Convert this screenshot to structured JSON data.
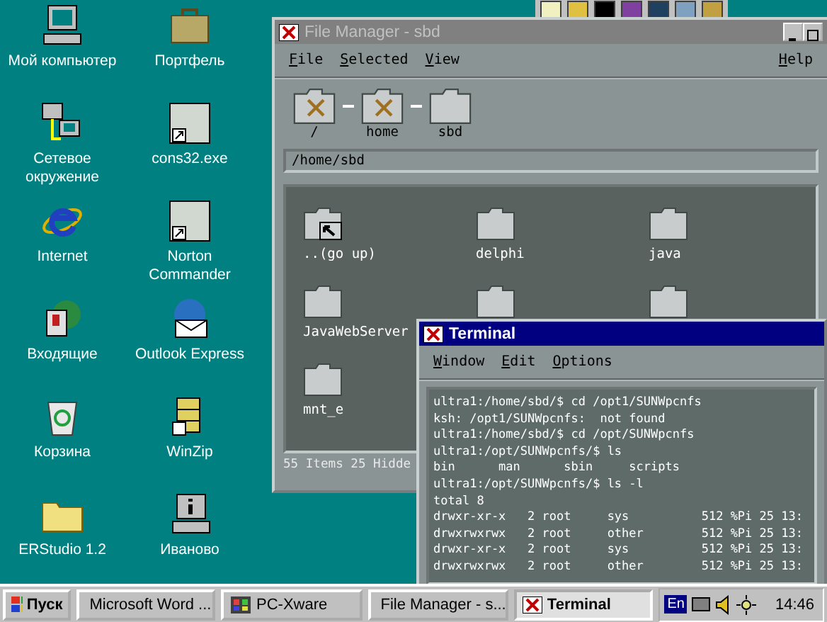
{
  "desktop_icons": [
    {
      "label": "Мой компьютер",
      "kind": "computer"
    },
    {
      "label": "Портфель",
      "kind": "briefcase"
    },
    {
      "label": "Сетевое окружение",
      "kind": "network"
    },
    {
      "label": "cons32.exe",
      "kind": "app"
    },
    {
      "label": "Internet",
      "kind": "browser"
    },
    {
      "label": "Norton Commander",
      "kind": "app"
    },
    {
      "label": "Входящие",
      "kind": "inbox"
    },
    {
      "label": "Outlook Express",
      "kind": "mail"
    },
    {
      "label": "Корзина",
      "kind": "trash"
    },
    {
      "label": "WinZip",
      "kind": "zip"
    },
    {
      "label": "ERStudio 1.2",
      "kind": "folder"
    },
    {
      "label": "Иваново",
      "kind": "info"
    }
  ],
  "file_manager": {
    "title": "File Manager - sbd",
    "active": false,
    "menu": [
      {
        "label": "File"
      },
      {
        "label": "Selected"
      },
      {
        "label": "View"
      }
    ],
    "help_menu": "Help",
    "path_segments": [
      {
        "label": "/",
        "kind": "mount"
      },
      {
        "label": "home",
        "kind": "mount"
      },
      {
        "label": "sbd",
        "kind": "folder"
      }
    ],
    "path_field": "/home/sbd",
    "files": [
      {
        "name": "..(go up)",
        "kind": "up"
      },
      {
        "name": "delphi",
        "kind": "folder"
      },
      {
        "name": "java",
        "kind": "folder"
      },
      {
        "name": "JavaWebServer",
        "kind": "folder"
      },
      {
        "kind": "folder"
      },
      {
        "kind": "folder"
      },
      {
        "name": "mnt_e",
        "kind": "folder"
      }
    ],
    "status": "55 Items 25 Hidde"
  },
  "terminal": {
    "title": "Terminal",
    "active": true,
    "menu": [
      {
        "label": "Window"
      },
      {
        "label": "Edit"
      },
      {
        "label": "Options"
      }
    ],
    "lines": [
      "ultra1:/home/sbd/$ cd /opt1/SUNWpcnfs",
      "ksh: /opt1/SUNWpcnfs:  not found",
      "ultra1:/home/sbd/$ cd /opt/SUNWpcnfs",
      "ultra1:/opt/SUNWpcnfs/$ ls",
      "bin      man      sbin     scripts",
      "ultra1:/opt/SUNWpcnfs/$ ls -l",
      "total 8",
      "drwxr-xr-x   2 root     sys          512 %Pi 25 13:",
      "drwxrwxrwx   2 root     other        512 %Pi 25 13:",
      "drwxr-xr-x   2 root     sys          512 %Pi 25 13:",
      "drwxrwxrwx   2 root     other        512 %Pi 25 13:"
    ]
  },
  "taskbar": {
    "start": "Пуск",
    "tasks": [
      {
        "label": "Microsoft Word ...",
        "kind": "word",
        "selected": false
      },
      {
        "label": "PC-Xware",
        "kind": "xware",
        "selected": false
      },
      {
        "label": "File Manager - s...",
        "kind": "x",
        "selected": false
      },
      {
        "label": "Terminal",
        "kind": "x",
        "selected": true
      }
    ],
    "language": "En",
    "clock": "14:46"
  }
}
